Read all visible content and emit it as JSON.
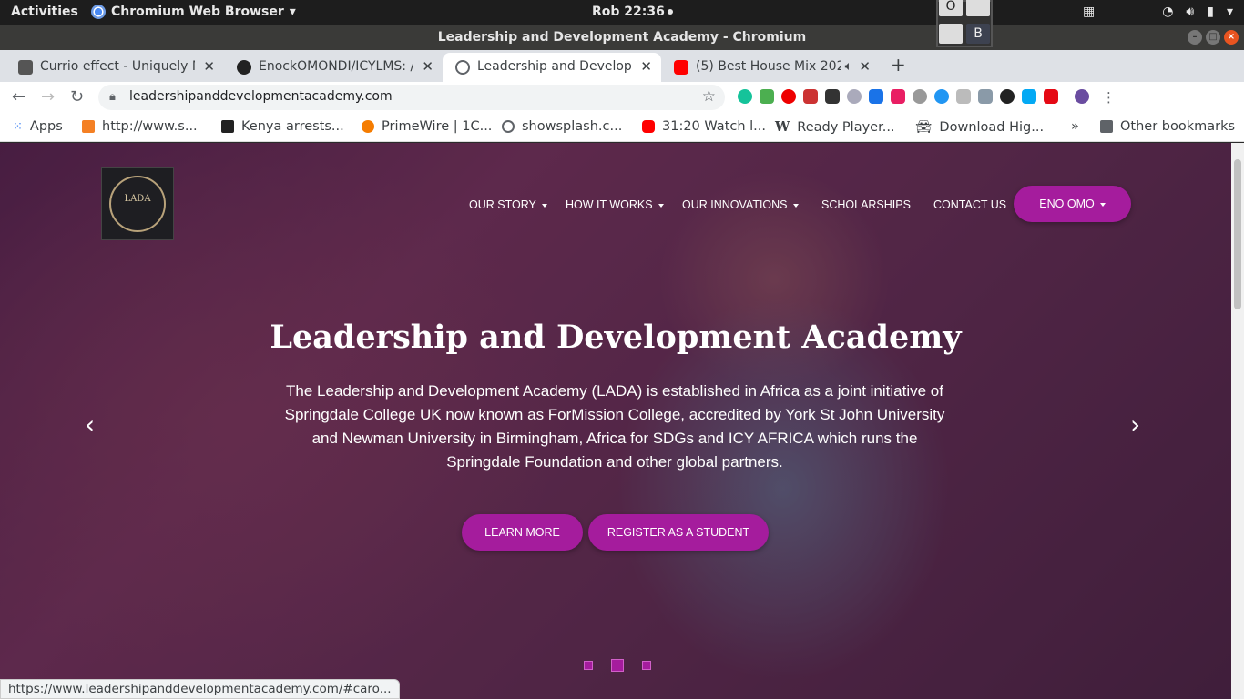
{
  "desktop": {
    "activities": "Activities",
    "app_name": "Chromium Web Browser",
    "clock": "Rob 22:36",
    "workspace_labels": [
      "O",
      "B"
    ]
  },
  "window": {
    "title": "Leadership and Development Academy - Chromium"
  },
  "tabs": [
    {
      "label": "Currio effect - Uniquely M",
      "icon": "curio-icon",
      "active": false
    },
    {
      "label": "EnockOMONDI/ICYLMS: /",
      "icon": "github-icon",
      "active": false
    },
    {
      "label": "Leadership and Develop",
      "icon": "globe-icon",
      "active": true
    },
    {
      "label": "(5) Best House Mix 202",
      "icon": "youtube-icon",
      "active": false,
      "audio": true
    }
  ],
  "address_bar": {
    "url": "leadershipanddevelopmentacademy.com"
  },
  "bookmarks": [
    {
      "label": "Apps"
    },
    {
      "label": "http://www.s..."
    },
    {
      "label": "Kenya arrests..."
    },
    {
      "label": "PrimeWire | 1C..."
    },
    {
      "label": "showsplash.c..."
    },
    {
      "label": "31:20 Watch l..."
    },
    {
      "label": "Ready Player..."
    },
    {
      "label": "Download Hig..."
    },
    {
      "label": "Other bookmarks"
    }
  ],
  "site": {
    "logo_text": "LADA",
    "nav": [
      {
        "label": "OUR STORY",
        "dropdown": true
      },
      {
        "label": "HOW IT WORKS",
        "dropdown": true
      },
      {
        "label": "OUR INNOVATIONS",
        "dropdown": true
      },
      {
        "label": "SCHOLARSHIPS",
        "dropdown": false
      },
      {
        "label": "CONTACT US",
        "dropdown": false
      }
    ],
    "user_menu": "ENO OMO",
    "hero": {
      "title": "Leadership and Development Academy",
      "text": "The Leadership and Development Academy (LADA) is established in Africa as a joint initiative of Springdale College UK now known as ForMission College, accredited by York St John University and Newman University in Birmingham, Africa for SDGs and ICY AFRICA which runs the Springdale Foundation and other global partners.",
      "buttons": [
        "LEARN MORE",
        "REGISTER AS A STUDENT"
      ],
      "prev": "‹",
      "next": "›"
    },
    "accent_color": "#a51c9d"
  },
  "status_bar": "https://www.leadershipanddevelopmentacademy.com/#caro..."
}
